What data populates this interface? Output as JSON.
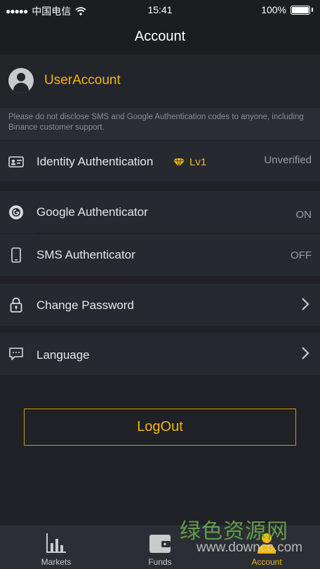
{
  "status_bar": {
    "carrier": "中国电信",
    "time": "15:41",
    "battery": "100%"
  },
  "nav": {
    "title": "Account"
  },
  "user": {
    "name": "UserAccount"
  },
  "notice": "Please do not disclose SMS and Google Authentication codes to anyone, including Binance customer support.",
  "identity": {
    "label": "Identity Authentication",
    "level": "Lv1",
    "status": "Unverified"
  },
  "security": [
    {
      "label": "Google Authenticator",
      "value": "ON"
    },
    {
      "label": "SMS Authenticator",
      "value": "OFF"
    }
  ],
  "change_password": {
    "label": "Change Password"
  },
  "language": {
    "label": "Language"
  },
  "logout": {
    "label": "LogOut"
  },
  "tabs": [
    {
      "label": "Markets",
      "icon": "chart-icon",
      "active": false
    },
    {
      "label": "Funds",
      "icon": "wallet-icon",
      "active": false
    },
    {
      "label": "Account",
      "icon": "user-icon",
      "active": true
    }
  ],
  "watermark": {
    "cn": "绿色资源网",
    "url": "www.downcc.com"
  },
  "colors": {
    "accent": "#f0b90b",
    "background": "#1f2126",
    "panel": "#26292f"
  }
}
